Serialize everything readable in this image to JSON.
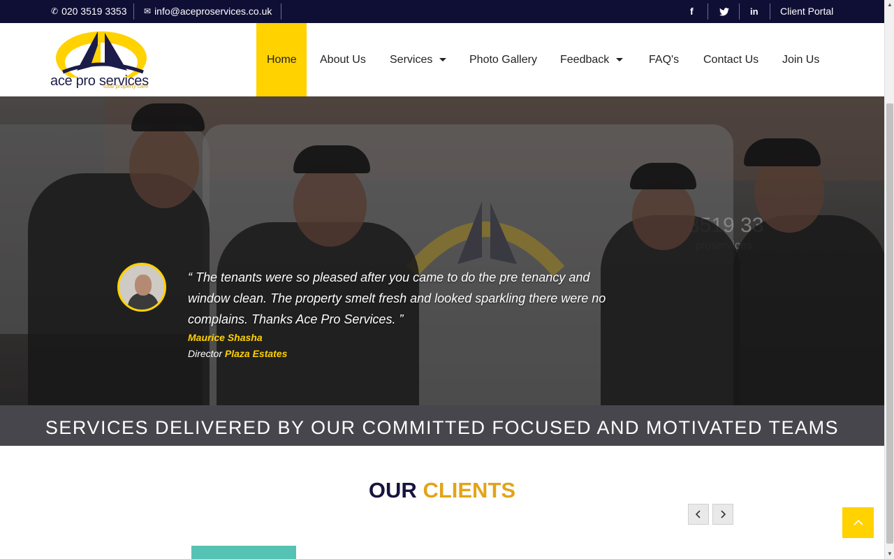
{
  "topbar": {
    "phone": "020 3519 3353",
    "email": "info@aceproservices.co.uk",
    "social": [
      {
        "icon": "facebook-icon",
        "label": "f"
      },
      {
        "icon": "twitter-icon",
        "label": "🐦"
      },
      {
        "icon": "linkedin-icon",
        "label": "in"
      }
    ],
    "client_portal": "Client Portal"
  },
  "logo": {
    "name": "ace pro services",
    "tagline": "total property care"
  },
  "nav": {
    "items": [
      {
        "label": "Home",
        "active": true
      },
      {
        "label": "About Us"
      },
      {
        "label": "Services",
        "dropdown": true
      },
      {
        "label": "Photo Gallery"
      },
      {
        "label": "Feedback",
        "dropdown": true
      },
      {
        "label": "FAQ's"
      },
      {
        "label": "Contact Us"
      },
      {
        "label": "Join Us"
      }
    ]
  },
  "hero": {
    "van_phone": "3519 33",
    "van_web": "proservices",
    "testimonial": {
      "quote": "“ The tenants were so pleased after you came to do the pre tenancy and window clean. The property smelt fresh and looked sparkling there were no complains. Thanks Ace Pro Services. ”",
      "name": "Maurice Shasha",
      "role": "Director",
      "company": "Plaza Estates"
    }
  },
  "banner": {
    "text": "SERVICES DELIVERED BY OUR COMMITTED FOCUSED AND MOTIVATED TEAMS"
  },
  "clients": {
    "title_part1": "OUR",
    "title_part2": "CLIENTS",
    "prev": "‹",
    "next": "›"
  },
  "back_to_top": "⌃",
  "colors": {
    "topbar_bg": "#0f0f36",
    "accent_yellow": "#ffd200",
    "navy": "#15153d",
    "gold": "#e2a418",
    "banner_bg": "#48464d"
  }
}
